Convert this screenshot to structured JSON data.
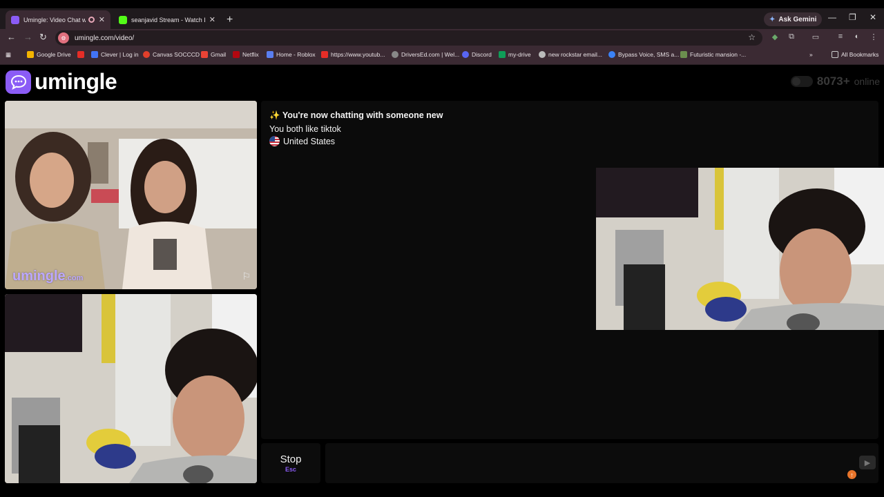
{
  "browser": {
    "tabs": [
      {
        "title": "Umingle: Video Chat with S",
        "active": true
      },
      {
        "title": "seanjavid Stream - Watch Live o",
        "active": false
      }
    ],
    "new_tab_icon": "plus-icon",
    "gemini_label": "Ask Gemini",
    "url": "umingle.com/video/",
    "bookmarks": [
      "Google Drive",
      "Clever | Log in",
      "Canvas SOCCCD",
      "Gmail",
      "Netflix",
      "Home - Roblox",
      "https://www.youtub...",
      "DriversEd.com | Wel...",
      "Discord",
      "my-drive",
      "new rockstar email...",
      "Bypass Voice, SMS a...",
      "Futuristic mansion -..."
    ],
    "all_bookmarks": "All Bookmarks"
  },
  "site": {
    "logo_text": "umingle",
    "online_count": "8073+",
    "online_label": "online",
    "watermark_main": "umingle",
    "watermark_suffix": ".com"
  },
  "chat": {
    "sparkle": "✨",
    "new_chat": "You're now chatting with someone new",
    "shared_interest": "You both like tiktok",
    "country": "United States"
  },
  "controls": {
    "stop_label": "Stop",
    "stop_shortcut": "Esc"
  },
  "colors": {
    "accent": "#8b5cf6",
    "chrome_tab": "#3b2a33",
    "background": "#000000"
  }
}
